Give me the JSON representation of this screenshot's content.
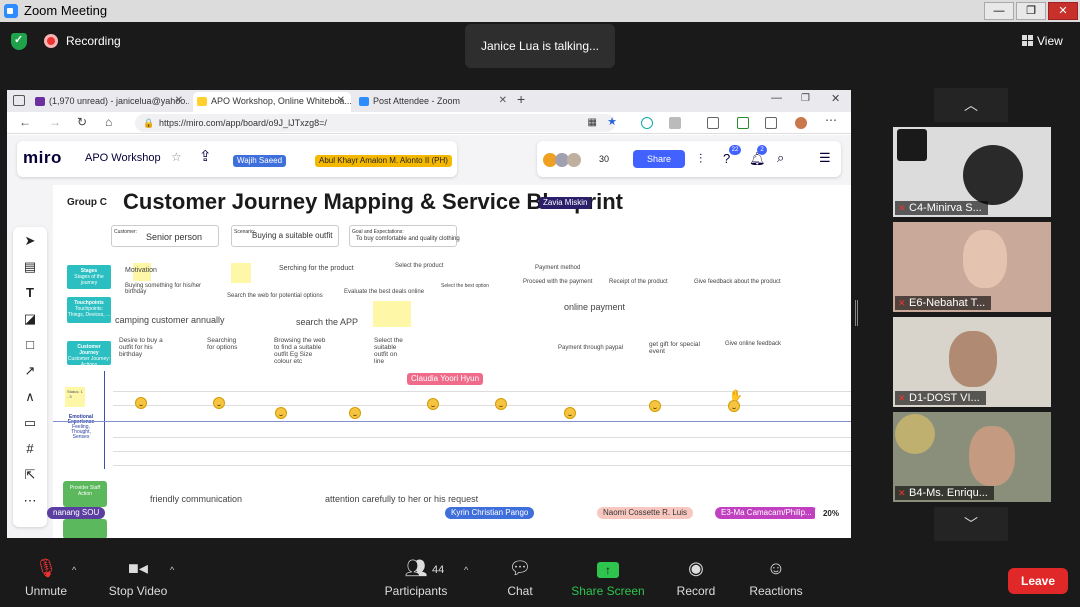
{
  "window": {
    "title": "Zoom Meeting"
  },
  "meeting": {
    "recording_label": "Recording",
    "talking_notice": "Janice Lua is talking...",
    "view_label": "View"
  },
  "browser": {
    "tabs": [
      {
        "label": "(1,970 unread) - janicelua@yahoo...",
        "icon_color": "#6b2fa0"
      },
      {
        "label": "APO Workshop, Online Whiteboa...",
        "icon_color": "#ffd02f"
      },
      {
        "label": "Post Attendee - Zoom",
        "icon_color": "#2d8cff"
      }
    ],
    "url": "https://miro.com/app/board/o9J_lJTxzg8=/"
  },
  "miro": {
    "logo": "miro",
    "board_name": "APO Workshop",
    "share_label": "Share",
    "participant_count": "30",
    "help_badge": "22",
    "notif_badge": "2",
    "zoom_level": "20%",
    "cursors": [
      {
        "name": "Wajih Saeed",
        "color": "#3f6fdb"
      },
      {
        "name": "Abul Khayr Amalon M. Alonto II (PH)",
        "color": "#f5b800"
      },
      {
        "name": "Zavia Miskin",
        "color": "#2a1f6b"
      },
      {
        "name": "Claudia Yoori Hyun",
        "color": "#f06a8a"
      }
    ],
    "bottom_cursors": [
      {
        "name": "nanang SOU",
        "color": "#5a3fa0"
      },
      {
        "name": "Kyrin Christian Pango",
        "color": "#3f6fdb"
      },
      {
        "name": "Naomi Cossette R. Luis",
        "color": "#f8c8c0"
      },
      {
        "name": "E3-Ma Camacam/Philip...",
        "color": "#c040c0"
      }
    ],
    "board": {
      "group": "Group C",
      "title": "Customer Journey Mapping & Service Blueprint",
      "customer_label": "Customer:",
      "customer": "Senior person",
      "scenario_label": "Scenario:",
      "scenario": "Buying a suitable outfit",
      "goal_label": "Goal and Expectations:",
      "goal": "To buy comfortable and quality clothing",
      "stages": [
        "Stages of the journey",
        "Touchpoints: Things, Devices, ...",
        "Customer Journey: Actions",
        "Status: 1 - 5"
      ],
      "stage_titles": [
        "Stages",
        "Touchpoints",
        "Customer Journey",
        "Status"
      ],
      "emotional_label": "Emotional Experience",
      "emotional_sub": "Feeling, Thought, Senses",
      "provider_label": "Provider Staff Action",
      "row1": [
        "Motivation",
        "Serching  for the product",
        "Select the product",
        "Payment method",
        "Buying something for his/her birthday",
        "Search the web for potential options",
        "Evaluate the best deals online",
        "Select the best option",
        "Proceed with the payment",
        "Receipt of the product",
        "Give feedback about the product"
      ],
      "row2": [
        "camping customer annually",
        "search the APP",
        "online payment"
      ],
      "row3": [
        "Desire to buy a outfit for his birthday",
        "Searching for options",
        "Browsing the web to find a suitable outfit Eg Size colour etc",
        "Select the suitable outfit on line",
        "Payment through paypal",
        "get gift for special event",
        "Give online feedback"
      ],
      "provider": [
        "friendly communication",
        "attention carefully to her or his request"
      ]
    }
  },
  "gallery": [
    {
      "name": "C4-Minirva S...",
      "bg": "#dcdcdc"
    },
    {
      "name": "E6-Nebahat T...",
      "bg": "#c9a99a"
    },
    {
      "name": "D1-DOST VI...",
      "bg": "#d8d4cc"
    },
    {
      "name": "B4-Ms. Enriqu...",
      "bg": "#8a8f7c"
    }
  ],
  "controls": {
    "unmute": "Unmute",
    "stop_video": "Stop Video",
    "participants": "Participants",
    "participants_count": "44",
    "chat": "Chat",
    "share_screen": "Share Screen",
    "record": "Record",
    "reactions": "Reactions",
    "leave": "Leave"
  }
}
